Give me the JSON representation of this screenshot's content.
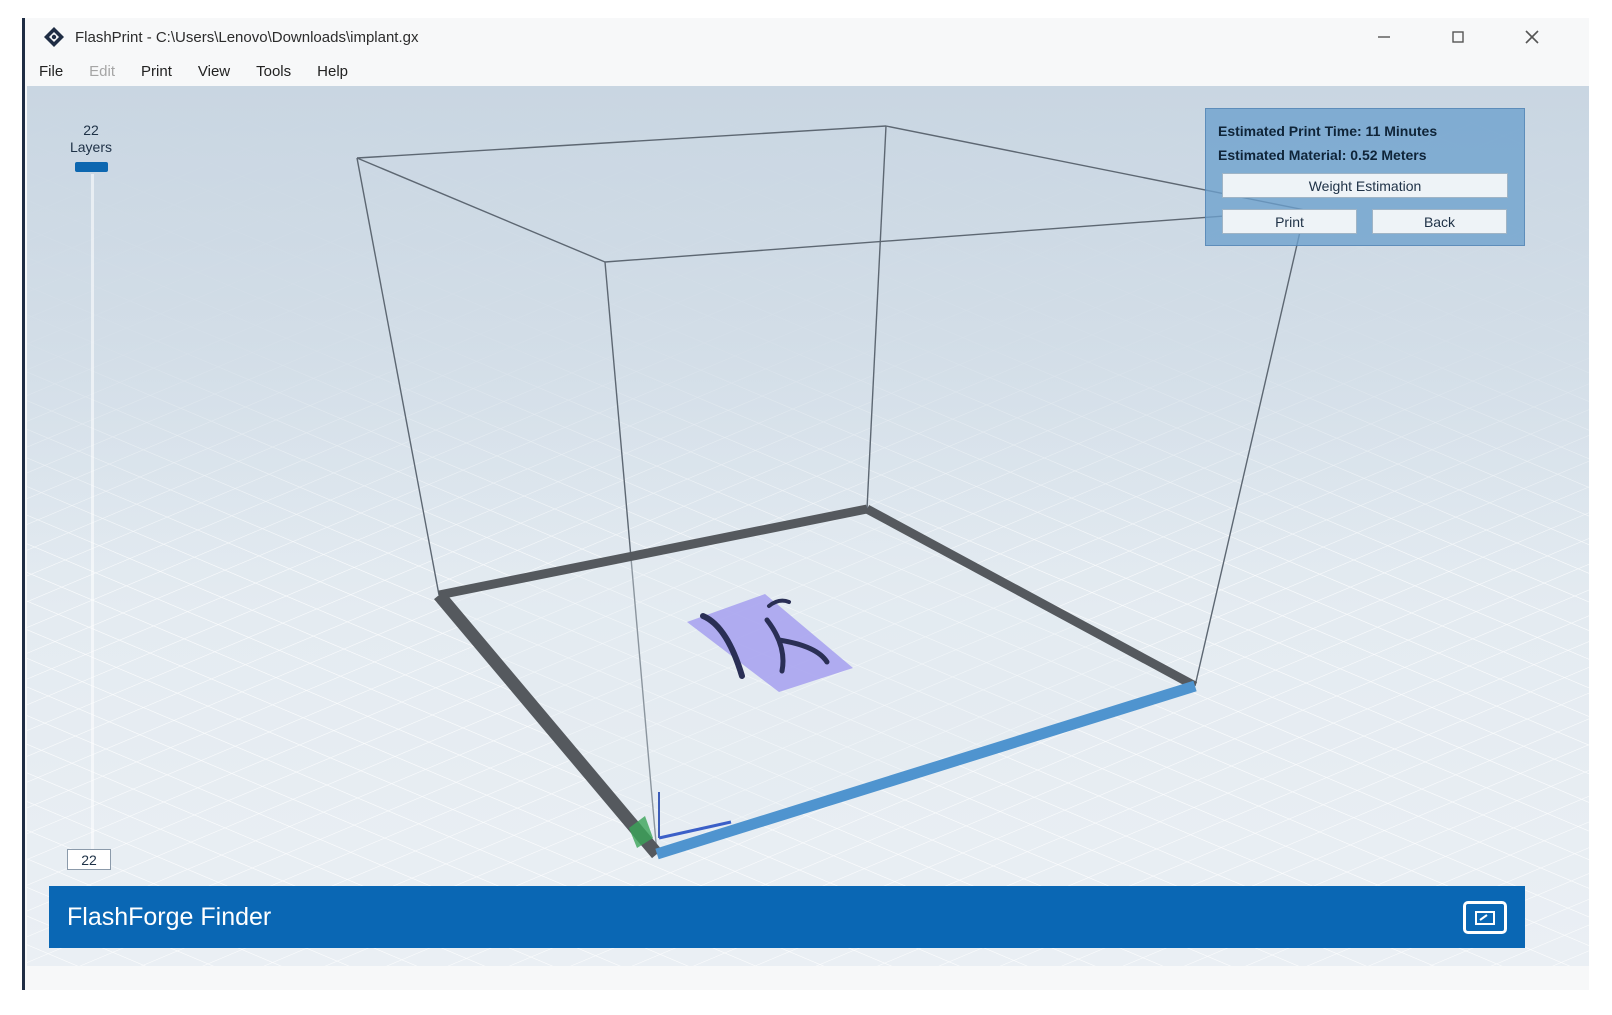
{
  "window": {
    "title": "FlashPrint - C:\\Users\\Lenovo\\Downloads\\implant.gx",
    "controls": [
      "minimize-icon",
      "maximize-icon",
      "close-icon"
    ]
  },
  "menu": {
    "items": [
      {
        "label": "File",
        "enabled": true
      },
      {
        "label": "Edit",
        "enabled": false
      },
      {
        "label": "Print",
        "enabled": true
      },
      {
        "label": "View",
        "enabled": true
      },
      {
        "label": "Tools",
        "enabled": true
      },
      {
        "label": "Help",
        "enabled": true
      }
    ]
  },
  "layers": {
    "top_count": "22",
    "top_label": "Layers",
    "bottom_value": "22"
  },
  "estimate": {
    "print_time": "Estimated Print Time:  11 Minutes",
    "material": "Estimated Material:  0.52 Meters",
    "weight_button": "Weight Estimation",
    "print_button": "Print",
    "back_button": "Back"
  },
  "finder": {
    "title": "FlashForge Finder",
    "icon": "window-icon"
  },
  "colors": {
    "accent": "#0a67b4",
    "panel": "#6ca0cd",
    "model": "#a9a4f0",
    "bed_front_edge": "#4f94cf",
    "bed_edges": "#55595e"
  }
}
